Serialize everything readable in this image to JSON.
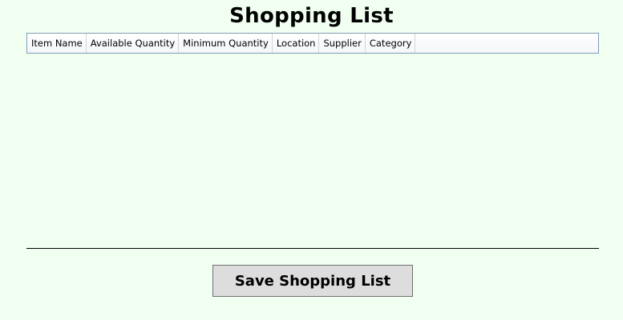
{
  "page": {
    "title": "Shopping List"
  },
  "grid": {
    "columns": [
      "Item Name",
      "Available Quantity",
      "Minimum Quantity",
      "Location",
      "Supplier",
      "Category"
    ],
    "rows": []
  },
  "actions": {
    "save_label": "Save Shopping List"
  },
  "colors": {
    "background": "#f0fff0",
    "button": "#dddddd",
    "grid_border": "#7f9db9"
  }
}
